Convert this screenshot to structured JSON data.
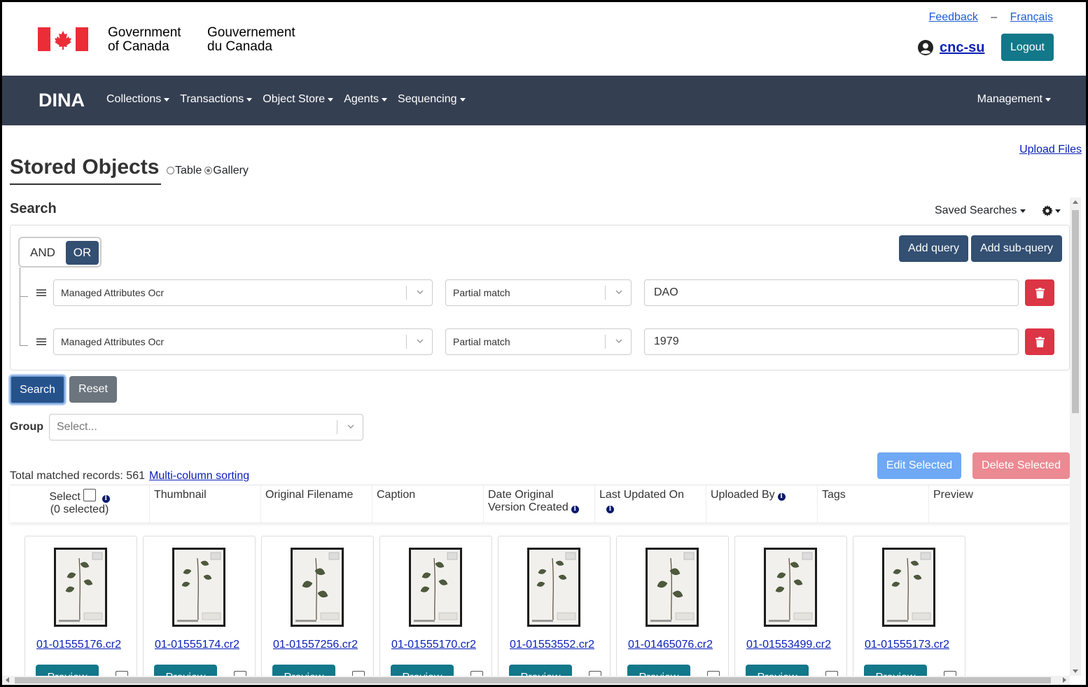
{
  "gov": {
    "name_en_line1": "Government",
    "name_en_line2": "of Canada",
    "name_fr_line1": "Gouvernement",
    "name_fr_line2": "du Canada",
    "feedback": "Feedback",
    "dash": "–",
    "francais": "Français",
    "username": "cnc-su",
    "logout": "Logout"
  },
  "nav": {
    "brand": "DINA",
    "items": [
      "Collections",
      "Transactions",
      "Object Store",
      "Agents",
      "Sequencing"
    ],
    "management": "Management"
  },
  "page": {
    "upload": "Upload Files",
    "title": "Stored Objects",
    "view_table": "Table",
    "view_gallery": "Gallery",
    "view_selected": "gallery"
  },
  "search": {
    "label": "Search",
    "saved_searches": "Saved Searches",
    "and": "AND",
    "or": "OR",
    "add_query": "Add query",
    "add_subquery": "Add sub-query",
    "rows": [
      {
        "field": "Managed Attributes Ocr",
        "match": "Partial match",
        "value": "DAO"
      },
      {
        "field": "Managed Attributes Ocr",
        "match": "Partial match",
        "value": "1979"
      }
    ],
    "search_btn": "Search",
    "reset_btn": "Reset"
  },
  "group": {
    "label": "Group",
    "placeholder": "Select..."
  },
  "results": {
    "total_label": "Total matched records: 561",
    "multi_sort": "Multi-column sorting",
    "edit_selected": "Edit Selected",
    "delete_selected": "Delete Selected",
    "columns": {
      "select": "Select",
      "selected_count": "(0 selected)",
      "thumbnail": "Thumbnail",
      "filename": "Original Filename",
      "caption": "Caption",
      "date_line1": "Date Original",
      "date_line2": "Version Created",
      "updated": "Last Updated On",
      "uploaded": "Uploaded By",
      "tags": "Tags",
      "preview": "Preview"
    },
    "cards": [
      {
        "file": "01-01555176.cr2",
        "button": "Preview"
      },
      {
        "file": "01-01555174.cr2",
        "button": "Preview"
      },
      {
        "file": "01-01557256.cr2",
        "button": "Preview"
      },
      {
        "file": "01-01555170.cr2",
        "button": "Preview"
      },
      {
        "file": "01-01553552.cr2",
        "button": "Preview"
      },
      {
        "file": "01-01465076.cr2",
        "button": "Preview"
      },
      {
        "file": "01-01553499.cr2",
        "button": "Preview"
      },
      {
        "file": "01-01555173.cr2",
        "button": "Preview"
      }
    ]
  },
  "colors": {
    "navbar": "#353f52",
    "primary": "#334f72",
    "teal": "#12788a",
    "danger": "#dc3545",
    "link": "#0b21b8"
  }
}
